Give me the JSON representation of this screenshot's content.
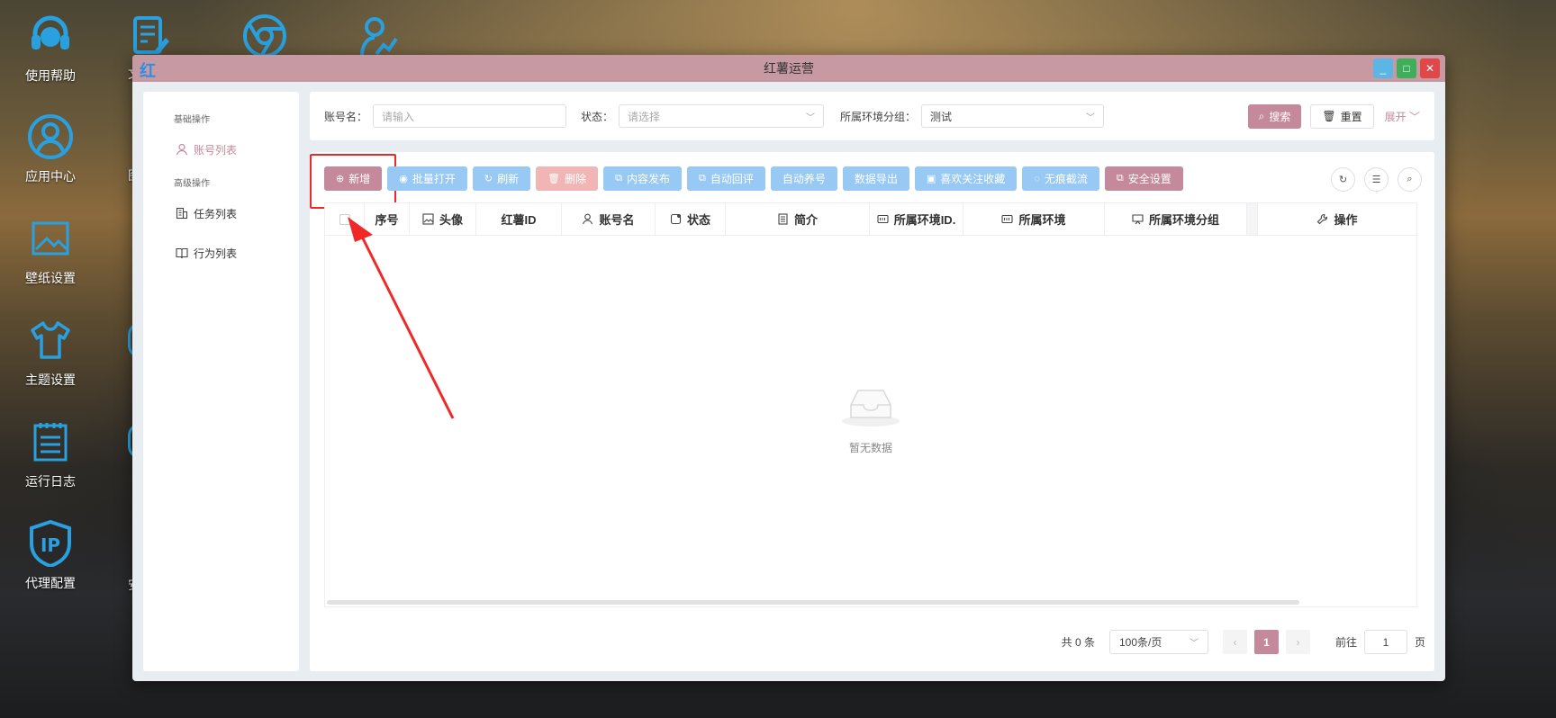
{
  "desktop": {
    "icons": [
      {
        "label": "使用帮助",
        "icon": "headset-icon"
      },
      {
        "label": "应用中心",
        "icon": "user-circle-icon"
      },
      {
        "label": "壁纸设置",
        "icon": "image-icon"
      },
      {
        "label": "主题设置",
        "icon": "shirt-icon"
      },
      {
        "label": "运行日志",
        "icon": "notepad-icon"
      },
      {
        "label": "代理配置",
        "icon": "ip-shield-icon"
      }
    ],
    "partial_labels": [
      "文",
      "图",
      "安"
    ]
  },
  "window": {
    "logo": "红",
    "title": "红薯运营",
    "buttons": {
      "minimize": "_",
      "maximize": "□",
      "close": "✕"
    }
  },
  "sidebar": {
    "group1": "基础操作",
    "item_accounts": "账号列表",
    "group2": "高级操作",
    "item_tasks": "任务列表",
    "item_behaviors": "行为列表"
  },
  "filter": {
    "account_label": "账号名：",
    "account_placeholder": "请输入",
    "status_label": "状态：",
    "status_placeholder": "请选择",
    "env_group_label": "所属环境分组：",
    "env_group_value": "测试",
    "search": "搜索",
    "reset": "重置",
    "expand": "展开"
  },
  "toolbar": {
    "add": "新增",
    "batch_open": "批量打开",
    "refresh": "刷新",
    "delete": "删除",
    "publish": "内容发布",
    "auto_reply": "自动回评",
    "auto_nurture": "自动养号",
    "export": "数据导出",
    "like_follow": "喜欢关注收藏",
    "traceless": "无痕截流",
    "security": "安全设置"
  },
  "table": {
    "columns": [
      "序号",
      "头像",
      "红薯ID",
      "账号名",
      "状态",
      "简介",
      "所属环境ID.",
      "所属环境",
      "所属环境分组",
      "操作"
    ],
    "empty_text": "暂无数据"
  },
  "pager": {
    "total": "共 0 条",
    "page_size": "100条/页",
    "current": "1",
    "goto_label": "前往",
    "goto_value": "1",
    "page_suffix": "页"
  },
  "colors": {
    "accent": "#c4899a",
    "titlebar": "#c79aa3",
    "blue_button": "#97c9f4",
    "highlight": "#f02828"
  }
}
